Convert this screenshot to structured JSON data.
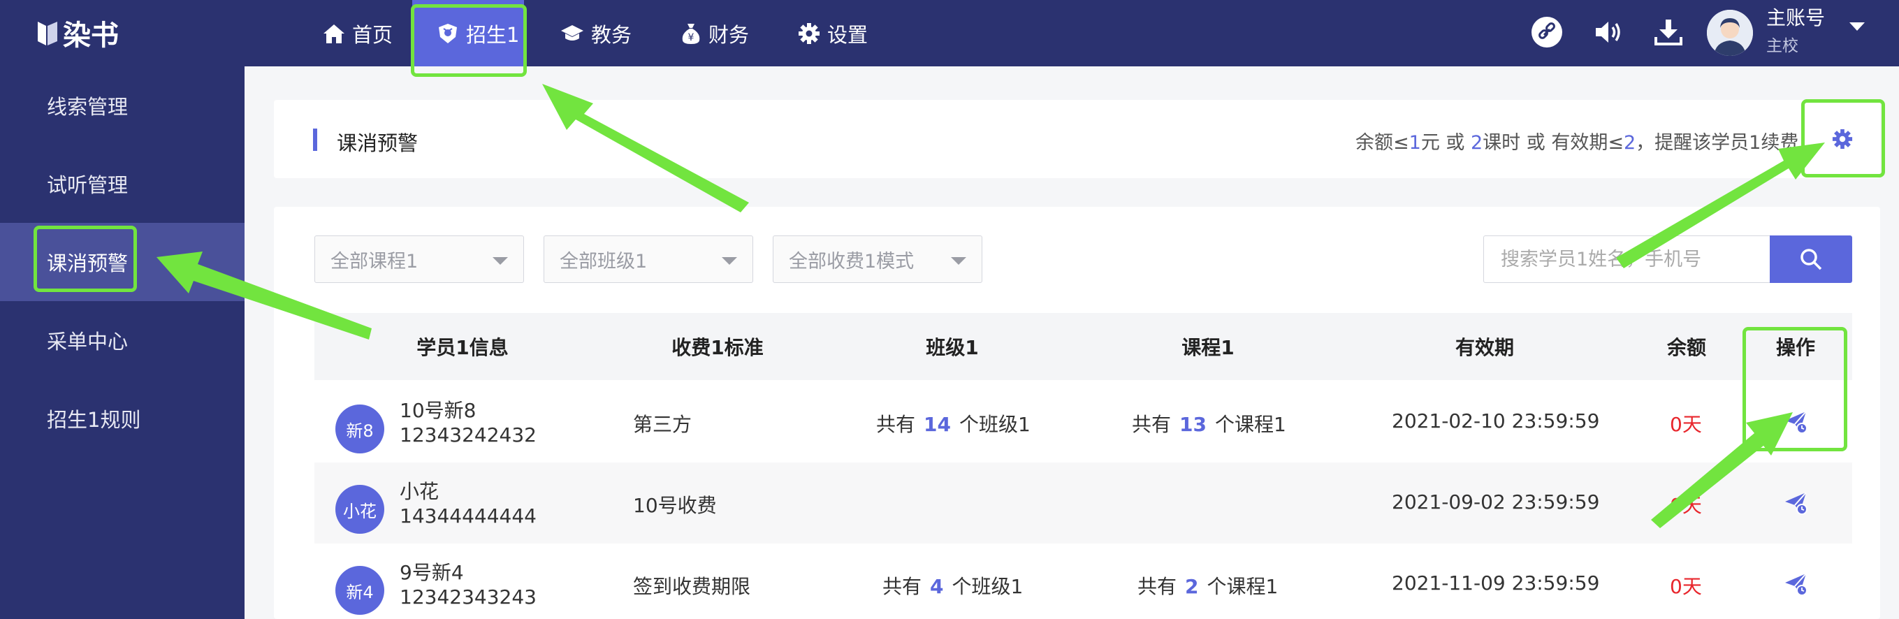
{
  "app": {
    "logo_text": "染书"
  },
  "topnav": [
    {
      "label": "首页",
      "icon": "home-icon"
    },
    {
      "label": "招生1",
      "icon": "shield-icon",
      "active": true
    },
    {
      "label": "教务",
      "icon": "graduation-cap-icon"
    },
    {
      "label": "财务",
      "icon": "money-bag-icon"
    },
    {
      "label": "设置",
      "icon": "gear-icon"
    }
  ],
  "account": {
    "name": "主账号",
    "role": "主校"
  },
  "top_icons": [
    "link-icon",
    "speaker-icon",
    "download-icon"
  ],
  "sidebar": {
    "items": [
      {
        "label": "线索管理"
      },
      {
        "label": "试听管理"
      },
      {
        "label": "课消预警",
        "active": true
      },
      {
        "label": "采单中心"
      },
      {
        "label": "招生1规则"
      }
    ]
  },
  "header_card": {
    "title": "课消预警",
    "remind": {
      "p1": "余额≤",
      "v1": "1",
      "p2": "元 或 ",
      "v2": "2",
      "p3": "课时 或 有效期≤",
      "v3": "2",
      "p4": "，提醒该学员1续费"
    }
  },
  "filters": {
    "course": "全部课程1",
    "class": "全部班级1",
    "fee_mode": "全部收费1模式",
    "search_placeholder": "搜索学员1姓名，手机号"
  },
  "table": {
    "headers": [
      "学员1信息",
      "收费1标准",
      "班级1",
      "课程1",
      "有效期",
      "余额",
      "操作"
    ],
    "rows": [
      {
        "avatar": "新8",
        "name": "10号新8",
        "phone": "12343242432",
        "fee": "第三方",
        "class_pre": "共有",
        "class_count": "14",
        "class_post": "个班级1",
        "course_pre": "共有",
        "course_count": "13",
        "course_post": "个课程1",
        "expire": "2021-02-10 23:59:59",
        "balance": "0天"
      },
      {
        "avatar": "小花",
        "name": "小花",
        "phone": "14344444444",
        "fee": "10号收费",
        "class_pre": "",
        "class_count": "",
        "class_post": "",
        "course_pre": "",
        "course_count": "",
        "course_post": "",
        "expire": "2021-09-02 23:59:59",
        "balance": "0天"
      },
      {
        "avatar": "新4",
        "name": "9号新4",
        "phone": "12342343243",
        "fee": "签到收费期限",
        "class_pre": "共有",
        "class_count": "4",
        "class_post": "个班级1",
        "course_pre": "共有",
        "course_count": "2",
        "course_post": "个课程1",
        "expire": "2021-11-09 23:59:59",
        "balance": "0天"
      }
    ]
  },
  "colors": {
    "nav_bg": "#2b3270",
    "accent": "#5b67dc",
    "sidebar_active": "#4a519a",
    "danger": "#e8262c",
    "annotation": "#72e43f"
  }
}
